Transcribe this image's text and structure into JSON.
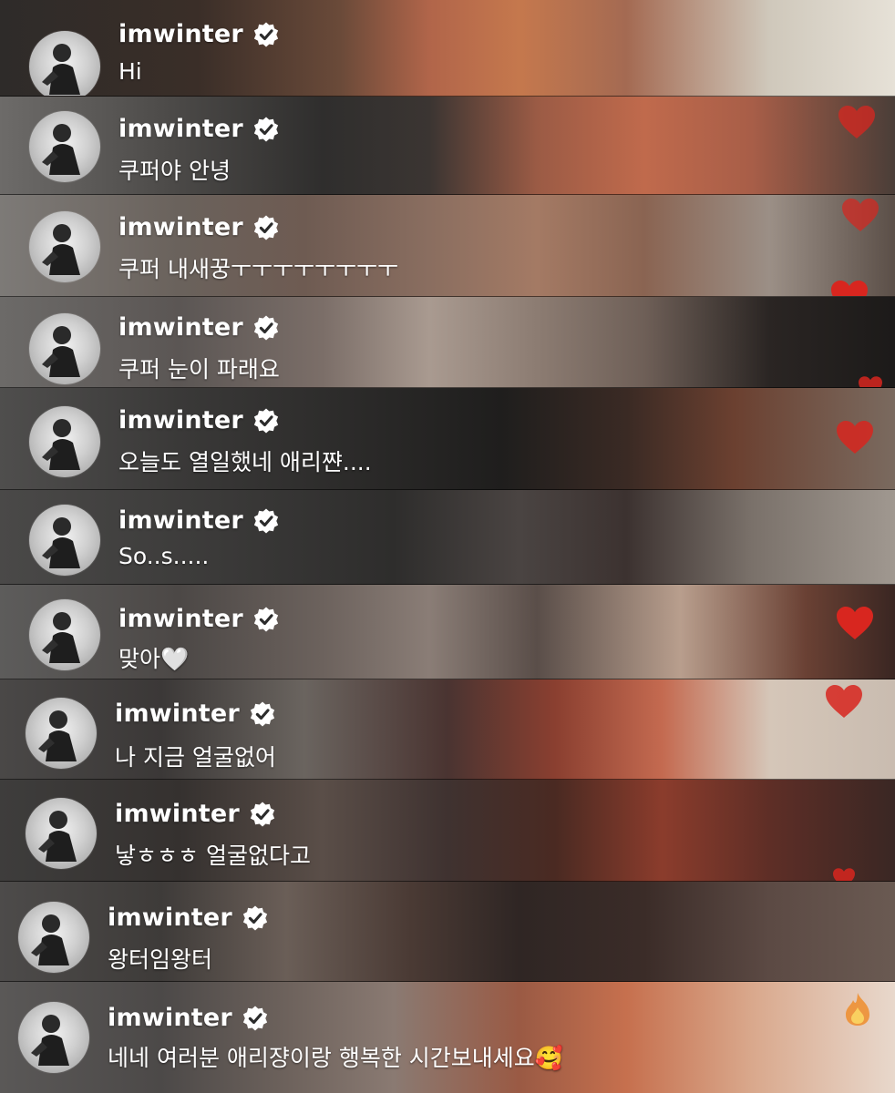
{
  "comments": [
    {
      "username": "imwinter",
      "message": "Hi"
    },
    {
      "username": "imwinter",
      "message": "쿠퍼야 안녕"
    },
    {
      "username": "imwinter",
      "message": "쿠퍼 내새꿍ㅜㅜㅜㅜㅜㅜㅜㅜ"
    },
    {
      "username": "imwinter",
      "message": "쿠퍼 눈이 파래요"
    },
    {
      "username": "imwinter",
      "message": "오늘도 열일했네 애리쨘...."
    },
    {
      "username": "imwinter",
      "message": "So..s....."
    },
    {
      "username": "imwinter",
      "message": "맞아🤍"
    },
    {
      "username": "imwinter",
      "message": "나 지금 얼굴없어"
    },
    {
      "username": "imwinter",
      "message": "낳ㅎㅎㅎ 얼굴없다고"
    },
    {
      "username": "imwinter",
      "message": "왕터임왕터"
    },
    {
      "username": "imwinter",
      "message": "네네 여러분 애리쟝이랑 행복한 시간보내세요🥰"
    }
  ],
  "icons": {
    "verified": "verified-badge-icon",
    "heart": "heart-reaction-icon",
    "fire": "fire-reaction-icon"
  },
  "colors": {
    "text": "#ffffff",
    "heart": "#d8261f",
    "verified_fill": "#ffffff",
    "verified_check": "#2b2b2b"
  }
}
